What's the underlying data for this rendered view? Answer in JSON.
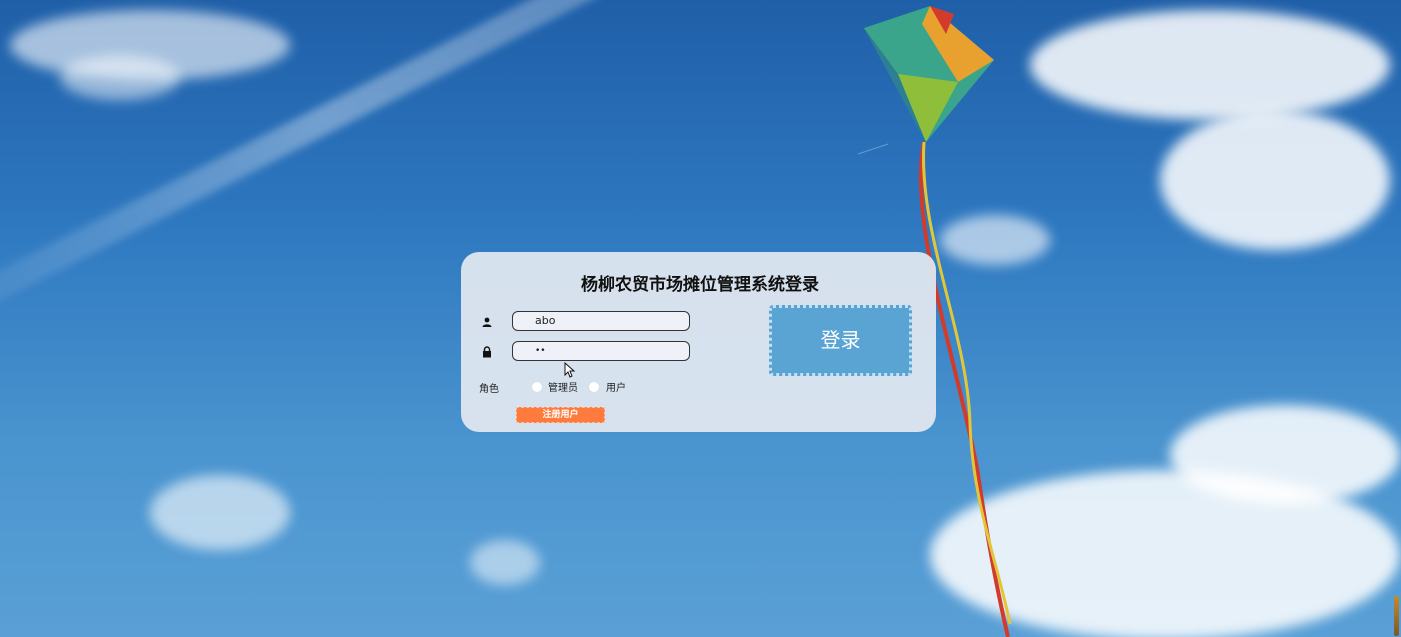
{
  "login": {
    "title": "杨柳农贸市场摊位管理系统登录",
    "username_value": "abo",
    "password_mask": "••",
    "role_label": "角色",
    "role_options": [
      "管理员",
      "用户"
    ],
    "register_label": "注册用户",
    "login_label": "登录"
  },
  "icons": {
    "user": "user-icon",
    "lock": "lock-icon",
    "cursor": "mouse-cursor-icon"
  },
  "colors": {
    "login_button": "#5aa4d4",
    "register_button": "#ff7a3d",
    "card": "#e2e8f0"
  }
}
